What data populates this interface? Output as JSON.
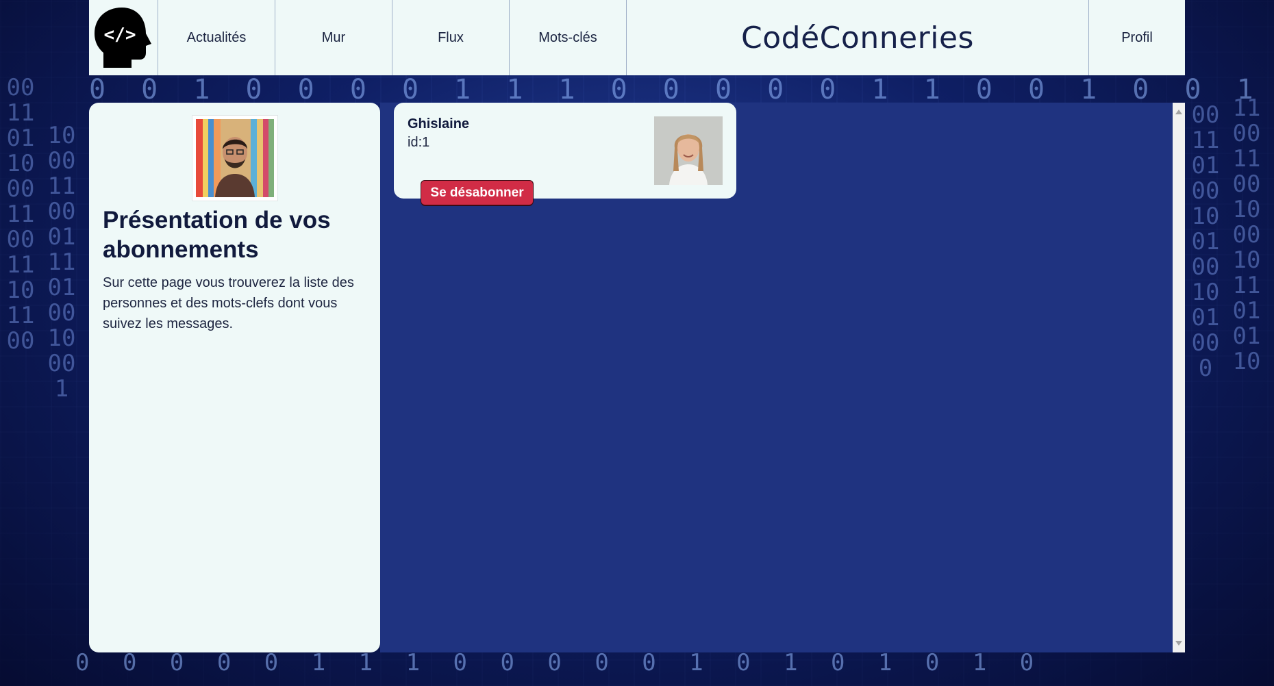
{
  "nav": {
    "logo_icon": "head-code-icon",
    "items": [
      {
        "label": "Actualités"
      },
      {
        "label": "Mur"
      },
      {
        "label": "Flux"
      },
      {
        "label": "Mots-clés"
      }
    ],
    "brand": "CodéConneries",
    "profile": "Profil"
  },
  "sidebar": {
    "avatar_icon": "user-avatar-photo",
    "title": "Présentation de vos abonnements",
    "description": "Sur cette page vous trouverez la liste des personnes et des mots-clefs dont vous suivez les messages."
  },
  "subscriptions": [
    {
      "name": "Ghislaine",
      "id_label": "id:1",
      "button": "Se désabonner",
      "photo_icon": "profile-photo"
    }
  ],
  "colors": {
    "navbar_bg": "#eff9f8",
    "main_bg": "#1f3380",
    "button_bg": "#d12c46",
    "brand_text": "#16214a",
    "brand_accent": "#d12c46"
  }
}
